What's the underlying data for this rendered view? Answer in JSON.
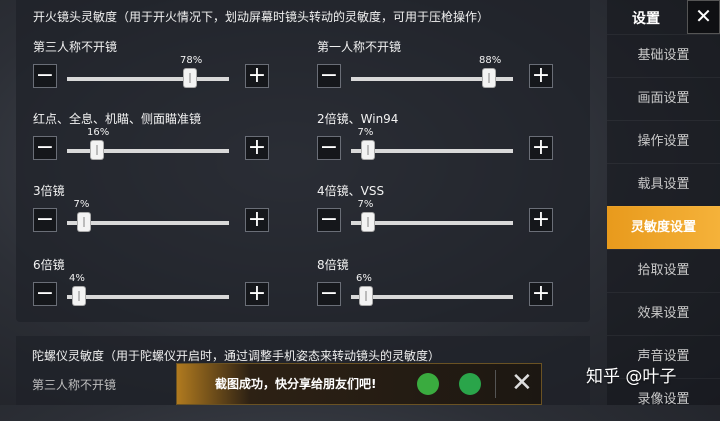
{
  "section": {
    "title": "开火镜头灵敏度（用于开火情况下，划动屏幕时镜头转动的灵敏度，可用于压枪操作）"
  },
  "sliders": [
    {
      "label": "第三人称不开镜",
      "value": 78,
      "value_text": "78%"
    },
    {
      "label": "第一人称不开镜",
      "value": 88,
      "value_text": "88%"
    },
    {
      "label": "红点、全息、机瞄、侧面瞄准镜",
      "value": 16,
      "value_text": "16%"
    },
    {
      "label": "2倍镜、Win94",
      "value": 7,
      "value_text": "7%"
    },
    {
      "label": "3倍镜",
      "value": 7,
      "value_text": "7%"
    },
    {
      "label": "4倍镜、VSS",
      "value": 7,
      "value_text": "7%"
    },
    {
      "label": "6倍镜",
      "value": 4,
      "value_text": "4%"
    },
    {
      "label": "8倍镜",
      "value": 6,
      "value_text": "6%"
    }
  ],
  "gyro": {
    "title": "陀螺仪灵敏度（用于陀螺仪开启时，通过调整手机姿态来转动镜头的灵敏度）",
    "first_item": "第三人称不开镜"
  },
  "sidebar": {
    "title": "设置",
    "close_symbol": "✕",
    "items": [
      {
        "label": "基础设置",
        "active": false
      },
      {
        "label": "画面设置",
        "active": false
      },
      {
        "label": "操作设置",
        "active": false
      },
      {
        "label": "载具设置",
        "active": false
      },
      {
        "label": "灵敏度设置",
        "active": true
      },
      {
        "label": "拾取设置",
        "active": false
      },
      {
        "label": "效果设置",
        "active": false
      },
      {
        "label": "声音设置",
        "active": false
      },
      {
        "label": "录像设置",
        "active": false
      }
    ]
  },
  "toast": {
    "text": "截图成功，快分享给朋友们吧!",
    "share_icons": [
      "wechat-icon",
      "moments-icon"
    ],
    "close_symbol": "✕"
  },
  "watermark": "知乎 @叶子",
  "colors": {
    "accent": "#f0a52a",
    "panel": "#1e2128",
    "track": "#d9d9d9"
  },
  "symbols": {
    "minus": "−",
    "plus": "+"
  }
}
